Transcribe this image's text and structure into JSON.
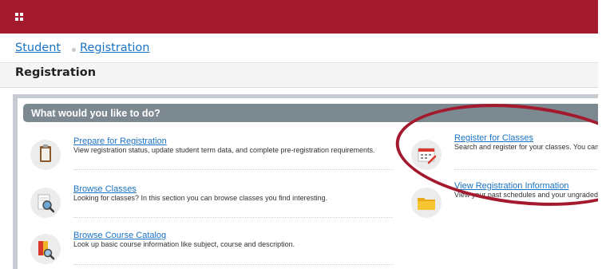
{
  "crumbs": {
    "student": "Student",
    "registration": "Registration"
  },
  "page": {
    "title": "Registration"
  },
  "panel": {
    "header": "What would you like to do?"
  },
  "items": {
    "prepare": {
      "link": "Prepare for Registration",
      "desc": "View registration status, update student term data, and complete pre-registration requirements."
    },
    "register": {
      "link": "Register for Classes",
      "desc": "Search and register for your classes. You can a"
    },
    "browse": {
      "link": "Browse Classes",
      "desc": "Looking for classes? In this section you can browse classes you find interesting."
    },
    "view": {
      "link": "View Registration Information",
      "desc": "View your past schedules and your ungraded c"
    },
    "catalog": {
      "link": "Browse Course Catalog",
      "desc": "Look up basic course information like subject, course and description."
    }
  },
  "colors": {
    "brand": "#a3192e",
    "link": "#1a73c5",
    "panel_header": "#7d8990"
  },
  "icons": {
    "prepare": "clipboard-icon",
    "register": "calendar-icon",
    "browse": "magnifier-document-icon",
    "view": "folder-icon",
    "catalog": "book-magnifier-icon"
  }
}
